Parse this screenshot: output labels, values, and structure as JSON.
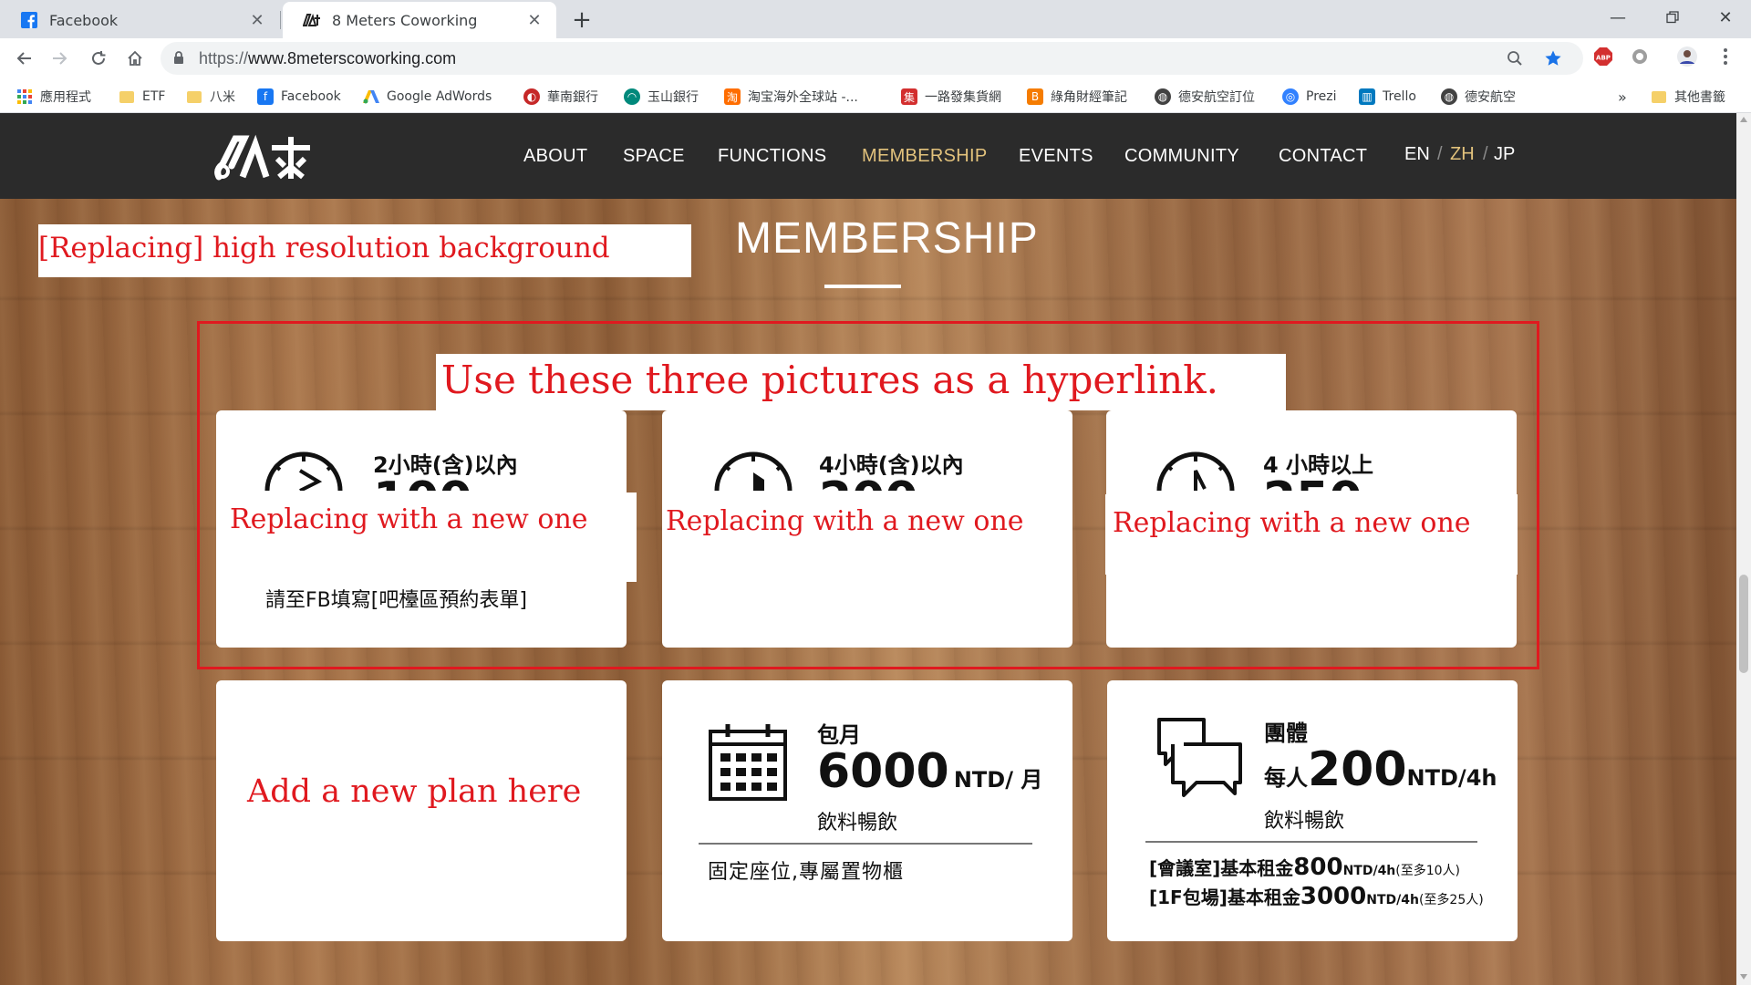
{
  "browser": {
    "tabs": [
      {
        "title": "Facebook",
        "icon": "facebook-icon"
      },
      {
        "title": "8 Meters Coworking",
        "icon": "8m-logo-icon"
      }
    ],
    "url_protocol": "https://",
    "url_host": "www.8meterscoworking.com",
    "bookmarks": [
      {
        "label": "應用程式",
        "icon": "apps-grid-icon"
      },
      {
        "label": "ETF",
        "icon": "folder-icon"
      },
      {
        "label": "八米",
        "icon": "folder-icon"
      },
      {
        "label": "Facebook",
        "icon": "facebook-icon"
      },
      {
        "label": "Google AdWords",
        "icon": "adwords-icon"
      },
      {
        "label": "華南銀行",
        "icon": "bank-icon"
      },
      {
        "label": "玉山銀行",
        "icon": "bank-icon"
      },
      {
        "label": "淘宝海外全球站 -...",
        "icon": "taobao-icon"
      },
      {
        "label": "一路發集貨網",
        "icon": "shipping-icon"
      },
      {
        "label": "綠角財經筆記",
        "icon": "blogger-icon"
      },
      {
        "label": "德安航空訂位",
        "icon": "globe-icon"
      },
      {
        "label": "Prezi",
        "icon": "prezi-icon"
      },
      {
        "label": "Trello",
        "icon": "trello-icon"
      },
      {
        "label": "德安航空",
        "icon": "globe-icon"
      }
    ],
    "more_bookmarks": "»",
    "other_bookmarks": "其他書籤",
    "extension_abp": "ABP"
  },
  "site": {
    "menu": [
      "ABOUT",
      "SPACE",
      "FUNCTIONS",
      "MEMBERSHIP",
      "EVENTS",
      "COMMUNITY",
      "CONTACT"
    ],
    "active_menu": "MEMBERSHIP",
    "languages": [
      "EN",
      "ZH",
      "JP"
    ],
    "language_separator": "/",
    "active_language": "ZH",
    "section_title": "MEMBERSHIP"
  },
  "annotations": {
    "background_note": "[Replacing] high resolution background",
    "hyperlink_note": "Use these three pictures as a hyperlink.",
    "replace_note": "Replacing with a new one",
    "new_plan_note": "Add a new plan here"
  },
  "cards": {
    "plan1": {
      "title": "2小時(含)以內",
      "partial_price": "100",
      "note": "請至FB填寫[吧檯區預約表單]"
    },
    "plan2": {
      "title": "4小時(含)以內",
      "partial_price": "200"
    },
    "plan3": {
      "title": "4 小時以上",
      "partial_price": "250"
    },
    "monthly": {
      "title": "包月",
      "price": "6000",
      "unit": "NTD/ 月",
      "perk": "飲料暢飲",
      "desc": "固定座位,專屬置物櫃"
    },
    "group": {
      "title": "團體",
      "prefix": "每人",
      "price": "200",
      "unit": "NTD/4h",
      "perk": "飲料暢飲",
      "line1_label": "[會議室]基本租金",
      "line1_price": "800",
      "line1_unit": "NTD/4h",
      "line1_note": "(至多10人)",
      "line2_label": "[1F包場]基本租金",
      "line2_price": "3000",
      "line2_unit": "NTD/4h",
      "line2_note": "(至多25人)"
    }
  },
  "colors": {
    "accent_gold": "#e2c27c",
    "annotation_red": "#e0191f",
    "nav_bg": "#2b2b2b"
  }
}
